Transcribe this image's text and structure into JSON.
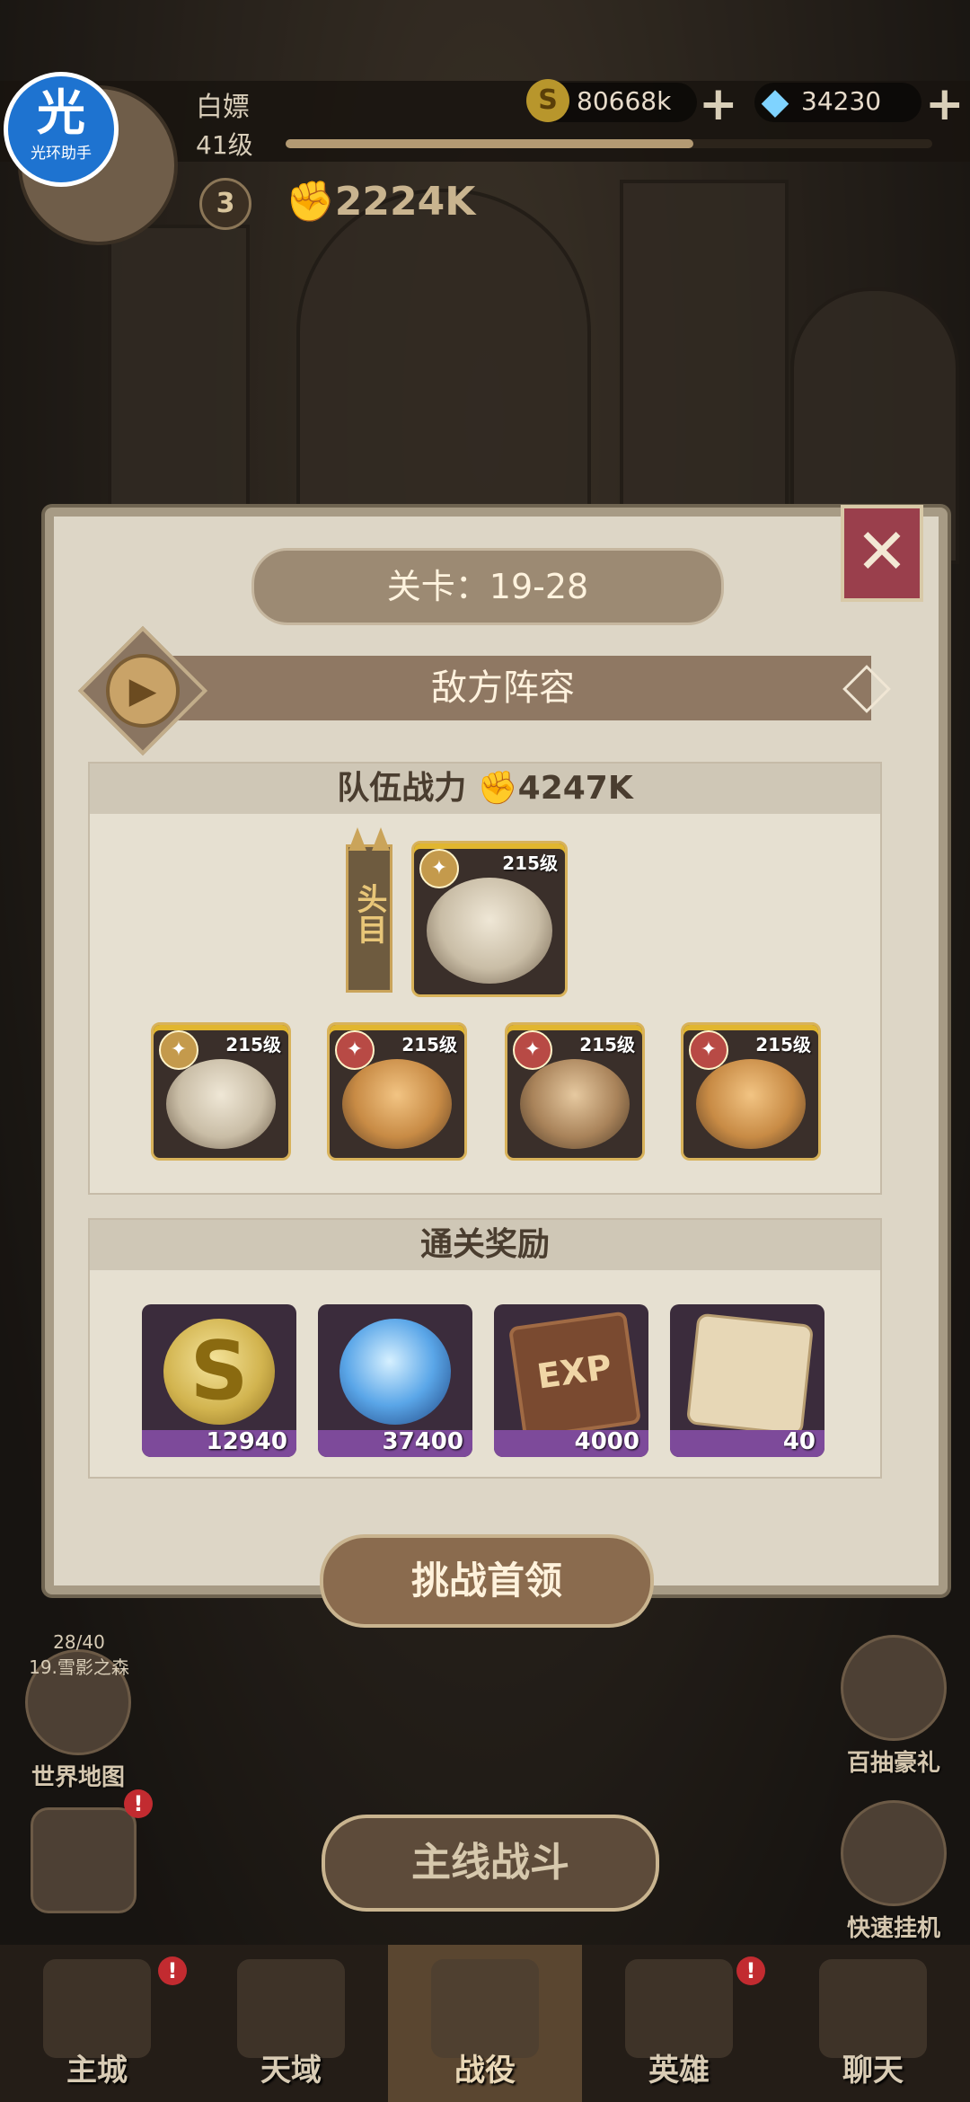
{
  "overlay_app": {
    "logo_char": "光",
    "logo_label": "光环助手"
  },
  "player": {
    "name": "白嫖",
    "level": "41级",
    "vip": "3",
    "power": "2224K",
    "xp_fraction": 0.63
  },
  "currency": {
    "gold": "80668k",
    "gems": "34230",
    "gold_icon": "S"
  },
  "stage": {
    "title": "关卡：19-28"
  },
  "enemy": {
    "header": "敌方阵容",
    "team_power_label": "队伍战力",
    "team_power": "4247K",
    "boss_tag": "头目",
    "boss": {
      "level": "215级",
      "faction": "gold"
    },
    "heroes": [
      {
        "level": "215级",
        "faction": "gold"
      },
      {
        "level": "215级",
        "faction": "red"
      },
      {
        "level": "215级",
        "faction": "red"
      },
      {
        "level": "215级",
        "faction": "red"
      }
    ]
  },
  "rewards": {
    "header": "通关奖励",
    "items": [
      {
        "icon": "gold-coin-icon",
        "qty": "12940"
      },
      {
        "icon": "spirit-orb-icon",
        "qty": "37400"
      },
      {
        "icon": "exp-book-icon",
        "qty": "4000",
        "icon_text": "EXP"
      },
      {
        "icon": "scroll-icon",
        "qty": "40"
      }
    ]
  },
  "buttons": {
    "challenge": "挑战首领",
    "main_battle": "主线战斗",
    "close": "✕"
  },
  "world": {
    "progress": "28/40",
    "area": "19.雪影之森",
    "label": "世界地图"
  },
  "side_right": {
    "gift": "百抽豪礼",
    "afk": "快速挂机"
  },
  "nav": [
    {
      "label": "主城",
      "badge": "!"
    },
    {
      "label": "天域",
      "badge": ""
    },
    {
      "label": "战役",
      "badge": "",
      "active": true
    },
    {
      "label": "英雄",
      "badge": "!"
    },
    {
      "label": "聊天",
      "badge": ""
    }
  ],
  "colors": {
    "accent_red": "#9a3f4c",
    "reward_strip": "#7d4a9a",
    "gold": "#e1b62f"
  }
}
